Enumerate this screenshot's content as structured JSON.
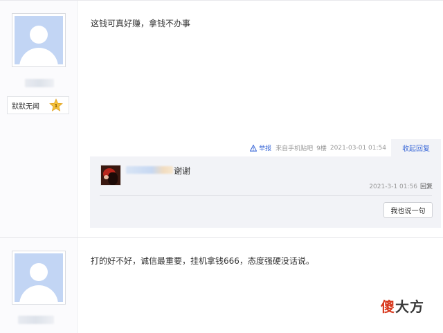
{
  "posts": [
    {
      "content": "这钱可真好赚，拿钱不办事",
      "level_badge": {
        "name": "默默无闻",
        "level": "1"
      },
      "meta": {
        "report_label": "举报",
        "source": "来自手机贴吧",
        "floor": "9楼",
        "time": "2021-03-01 01:54",
        "collapse_label": "收起回复"
      },
      "reply": {
        "text": "谢谢",
        "time": "2021-3-1 01:56",
        "reply_label": "回复",
        "say_button": "我也说一句"
      }
    },
    {
      "content": "打的好不好，诚信最重要，挂机拿钱666，态度强硬没话说。"
    }
  ],
  "watermark": {
    "part1": "傻",
    "part2": "大方"
  },
  "colors": {
    "link": "#3e6bd8",
    "avatar_bg": "#c2d5f4",
    "star": "#f4c23b"
  },
  "icons": [
    "default-avatar-icon",
    "level-star-icon",
    "report-warning-icon"
  ]
}
